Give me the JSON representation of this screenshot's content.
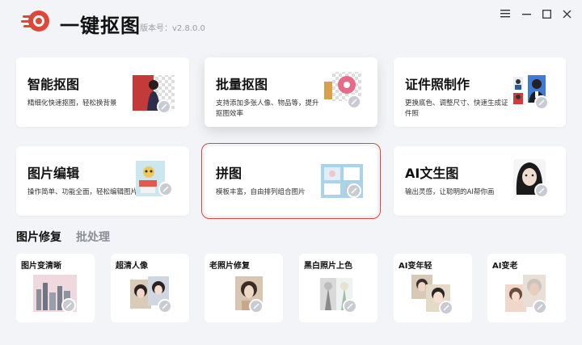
{
  "app": {
    "name": "一键抠图",
    "version": "版本号：v2.8.0.0",
    "accent": "#e0473a"
  },
  "window_controls": [
    "menu-icon",
    "minimize-icon",
    "maximize-icon",
    "close-icon"
  ],
  "features": [
    {
      "title": "智能抠图",
      "desc": "精细化快速抠图，轻松换背景",
      "icon": "portrait-thumbnail"
    },
    {
      "title": "批量抠图",
      "desc": "支持添加多张人像、物品等，提升抠图效率",
      "icon": "donut-thumbnail"
    },
    {
      "title": "证件照制作",
      "desc": "更换底色、调整尺寸、快速生成证件照",
      "icon": "id-photo-thumbnail"
    },
    {
      "title": "图片编辑",
      "desc": "操作简单、功能全面，轻松编辑图片",
      "icon": "edit-thumbnail"
    },
    {
      "title": "拼图",
      "desc": "模板丰富，自由排列组合图片",
      "icon": "collage-thumbnail"
    },
    {
      "title": "AI文生图",
      "desc": "输出灵感，让聪明的AI帮你画",
      "icon": "ai-portrait-thumbnail"
    }
  ],
  "section_tabs": [
    {
      "label": "图片修复",
      "active": true
    },
    {
      "label": "批处理",
      "active": false
    }
  ],
  "repair_tools": [
    {
      "title": "图片变清晰"
    },
    {
      "title": "超清人像"
    },
    {
      "title": "老照片修复"
    },
    {
      "title": "黑白照片上色"
    },
    {
      "title": "AI变年轻"
    },
    {
      "title": "AI变老"
    }
  ]
}
